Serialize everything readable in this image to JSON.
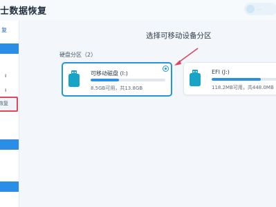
{
  "app": {
    "title": "士数据恢复",
    "top_badge_text": "..."
  },
  "sidebar": {
    "items": [
      {
        "label": "复",
        "color": "#2b6cb0"
      },
      {
        "label": "ı",
        "color": "#333333"
      },
      {
        "label": "ı",
        "color": "#333333"
      },
      {
        "label": "恢复",
        "color": "#4a5f73",
        "selected": true
      }
    ]
  },
  "main": {
    "heading": "选择可移动设备分区",
    "section_title": "硬盘分区（2）",
    "partitions": [
      {
        "name": "可移动磁盘 (I:)",
        "size_text": "8.5GB可用，共13.8GB",
        "used_fraction": 0.38,
        "selected": true
      },
      {
        "name": "EFI (J:)",
        "size_text": "118.2MB可用，共448.0MB",
        "used_fraction": 0.74,
        "selected": false
      }
    ]
  },
  "colors": {
    "accent": "#2b8ee6",
    "selected_border": "#1f96d8",
    "annotation_red": "#e0455b",
    "icon_teal": "#17a4c6"
  }
}
